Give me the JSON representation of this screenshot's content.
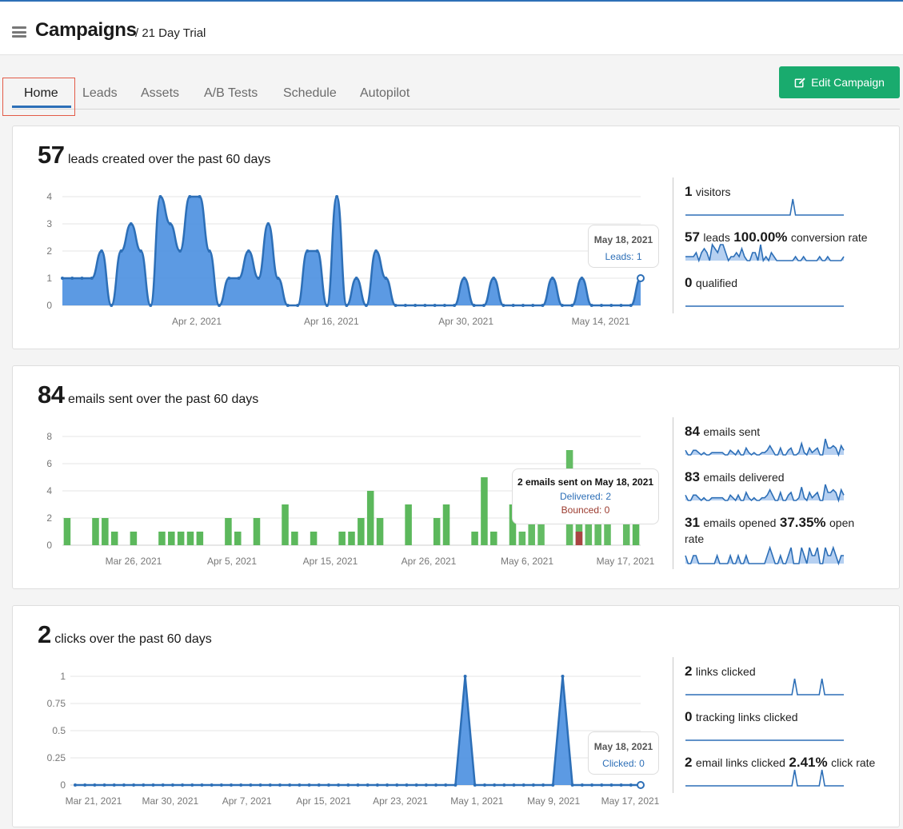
{
  "header": {
    "title": "Campaigns",
    "subtitle": "/ 21 Day Trial"
  },
  "tabs": [
    "Home",
    "Leads",
    "Assets",
    "A/B Tests",
    "Schedule",
    "Autopilot"
  ],
  "edit_button": {
    "label": "Edit Campaign"
  },
  "colors": {
    "accent": "#2d6fb7",
    "area": "#4a8fe0",
    "bar": "#5cb85c",
    "bounced": "#a94442",
    "button": "#19ab6e"
  },
  "leads_panel": {
    "count": "57",
    "label": "leads created over the past 60 days",
    "tooltip": {
      "date": "May 18, 2021",
      "value": "Leads: 1"
    },
    "stats": {
      "visitors_n": "1",
      "visitors_t": "visitors",
      "leads_n": "57",
      "leads_t": "leads",
      "conv_n": "100.00%",
      "conv_t": "conversion rate",
      "qualified_n": "0",
      "qualified_t": "qualified"
    }
  },
  "emails_panel": {
    "count": "84",
    "label": "emails sent over the past 60 days",
    "tooltip": {
      "title": "2 emails sent on May 18, 2021",
      "delivered": "Delivered: 2",
      "bounced": "Bounced: 0"
    },
    "stats": {
      "sent_n": "84",
      "sent_t": "emails sent",
      "delivered_n": "83",
      "delivered_t": "emails delivered",
      "opened_n": "31",
      "opened_t": "emails opened",
      "rate_n": "37.35%",
      "rate_t": "open",
      "rate_t2": "rate"
    }
  },
  "clicks_panel": {
    "count": "2",
    "label": "clicks over the past 60 days",
    "tooltip": {
      "date": "May 18, 2021",
      "value": "Clicked: 0"
    },
    "stats": {
      "links_n": "2",
      "links_t": "links clicked",
      "tracking_n": "0",
      "tracking_t": "tracking links clicked",
      "email_n": "2",
      "email_t": "email links clicked",
      "click_n": "2.41%",
      "click_t": "click rate"
    }
  },
  "chart_data": [
    {
      "type": "area",
      "title": "57 leads created over the past 60 days",
      "x_ticks": [
        "Apr 2, 2021",
        "Apr 16, 2021",
        "Apr 30, 2021",
        "May 14, 2021"
      ],
      "y_ticks": [
        "0",
        "1",
        "2",
        "3",
        "4"
      ],
      "ylim": [
        0,
        4
      ],
      "values": [
        1,
        1,
        1,
        1,
        2,
        0,
        2,
        3,
        2,
        0,
        4,
        3,
        2,
        4,
        4,
        2,
        0,
        1,
        1,
        2,
        1,
        3,
        1,
        0,
        0,
        2,
        2,
        0,
        4,
        0,
        1,
        0,
        2,
        1,
        0,
        0,
        0,
        0,
        0,
        0,
        0,
        1,
        0,
        0,
        1,
        0,
        0,
        0,
        0,
        0,
        1,
        0,
        0,
        1,
        0,
        0,
        0,
        0,
        0,
        1
      ],
      "grid": true
    },
    {
      "type": "bar",
      "title": "84 emails sent over the past 60 days",
      "x_ticks": [
        "Mar 26, 2021",
        "Apr 5, 2021",
        "Apr 15, 2021",
        "Apr 26, 2021",
        "May 6, 2021",
        "May 17, 2021"
      ],
      "y_ticks": [
        "0",
        "2",
        "4",
        "6",
        "8"
      ],
      "ylim": [
        0,
        8
      ],
      "series": [
        {
          "name": "Delivered",
          "values": [
            2,
            0,
            0,
            2,
            2,
            1,
            0,
            1,
            0,
            0,
            1,
            1,
            1,
            1,
            1,
            0,
            0,
            2,
            1,
            0,
            2,
            0,
            0,
            3,
            1,
            0,
            1,
            0,
            0,
            1,
            1,
            2,
            4,
            2,
            0,
            0,
            3,
            0,
            0,
            2,
            3,
            0,
            0,
            1,
            5,
            1,
            0,
            3,
            1,
            2,
            3,
            0,
            0,
            7,
            3,
            3,
            4,
            3,
            0,
            4,
            2
          ]
        },
        {
          "name": "Bounced",
          "values": [
            0,
            0,
            0,
            0,
            0,
            0,
            0,
            0,
            0,
            0,
            0,
            0,
            0,
            0,
            0,
            0,
            0,
            0,
            0,
            0,
            0,
            0,
            0,
            0,
            0,
            0,
            0,
            0,
            0,
            0,
            0,
            0,
            0,
            0,
            0,
            0,
            0,
            0,
            0,
            0,
            0,
            0,
            0,
            0,
            0,
            0,
            0,
            0,
            0,
            0,
            0,
            0,
            0,
            0,
            1,
            0,
            0,
            0,
            0,
            0,
            0
          ]
        }
      ],
      "grid": true
    },
    {
      "type": "area",
      "title": "2 clicks over the past 60 days",
      "x_ticks": [
        "Mar 21, 2021",
        "Mar 30, 2021",
        "Apr 7, 2021",
        "Apr 15, 2021",
        "Apr 23, 2021",
        "May 1, 2021",
        "May 9, 2021",
        "May 17, 2021"
      ],
      "y_ticks": [
        "0",
        "0.25",
        "0.5",
        "0.75",
        "1"
      ],
      "ylim": [
        0,
        1
      ],
      "values": [
        0,
        0,
        0,
        0,
        0,
        0,
        0,
        0,
        0,
        0,
        0,
        0,
        0,
        0,
        0,
        0,
        0,
        0,
        0,
        0,
        0,
        0,
        0,
        0,
        0,
        0,
        0,
        0,
        0,
        0,
        0,
        0,
        0,
        0,
        0,
        0,
        0,
        0,
        0,
        0,
        1,
        0,
        0,
        0,
        0,
        0,
        0,
        0,
        0,
        0,
        1,
        0,
        0,
        0,
        0,
        0,
        0,
        0,
        0
      ],
      "grid": true
    }
  ],
  "sparklines": {
    "visitors": [
      0,
      0,
      0,
      0,
      0,
      0,
      0,
      0,
      0,
      0,
      0,
      0,
      0,
      0,
      0,
      0,
      0,
      0,
      0,
      0,
      0,
      0,
      0,
      0,
      0,
      0,
      0,
      0,
      0,
      0,
      0,
      0,
      0,
      0,
      0,
      0,
      0,
      0,
      0,
      0,
      1,
      0,
      0,
      0,
      0,
      0,
      0,
      0,
      0,
      0,
      0,
      0,
      0,
      0,
      0,
      0,
      0,
      0,
      0,
      0
    ],
    "leads": [
      1,
      1,
      1,
      1,
      2,
      0,
      2,
      3,
      2,
      0,
      4,
      3,
      2,
      4,
      4,
      2,
      0,
      1,
      1,
      2,
      1,
      3,
      1,
      0,
      0,
      2,
      2,
      0,
      4,
      0,
      1,
      0,
      2,
      1,
      0,
      0,
      0,
      0,
      0,
      0,
      0,
      1,
      0,
      0,
      1,
      0,
      0,
      0,
      0,
      0,
      1,
      0,
      0,
      1,
      0,
      0,
      0,
      0,
      0,
      1
    ],
    "qualified": [
      0,
      0,
      0,
      0,
      0,
      0,
      0,
      0,
      0,
      0,
      0,
      0,
      0,
      0,
      0,
      0,
      0,
      0,
      0,
      0,
      0,
      0,
      0,
      0,
      0,
      0,
      0,
      0,
      0,
      0,
      0,
      0,
      0,
      0,
      0,
      0,
      0,
      0,
      0,
      0,
      0,
      0,
      0,
      0,
      0,
      0,
      0,
      0,
      0,
      0,
      0,
      0,
      0,
      0,
      0,
      0,
      0,
      0,
      0,
      0
    ],
    "sent": [
      2,
      0,
      0,
      2,
      2,
      1,
      0,
      1,
      0,
      0,
      1,
      1,
      1,
      1,
      1,
      0,
      0,
      2,
      1,
      0,
      2,
      0,
      0,
      3,
      1,
      0,
      1,
      0,
      0,
      1,
      1,
      2,
      4,
      2,
      0,
      0,
      3,
      0,
      0,
      2,
      3,
      0,
      0,
      1,
      5,
      1,
      0,
      3,
      1,
      2,
      3,
      0,
      0,
      7,
      3,
      3,
      4,
      3,
      0,
      4,
      2
    ],
    "delivered": [
      2,
      0,
      0,
      2,
      2,
      1,
      0,
      1,
      0,
      0,
      1,
      1,
      1,
      1,
      1,
      0,
      0,
      2,
      1,
      0,
      2,
      0,
      0,
      3,
      1,
      0,
      1,
      0,
      0,
      1,
      1,
      2,
      4,
      2,
      0,
      0,
      3,
      0,
      0,
      2,
      3,
      0,
      0,
      1,
      5,
      1,
      0,
      3,
      1,
      2,
      3,
      0,
      0,
      6,
      3,
      3,
      4,
      3,
      0,
      4,
      2
    ],
    "opened": [
      1,
      0,
      0,
      1,
      1,
      0,
      0,
      0,
      0,
      0,
      0,
      0,
      1,
      0,
      0,
      0,
      0,
      1,
      0,
      0,
      1,
      0,
      0,
      1,
      0,
      0,
      0,
      0,
      0,
      0,
      0,
      1,
      2,
      1,
      0,
      0,
      1,
      0,
      0,
      1,
      2,
      0,
      0,
      0,
      2,
      1,
      0,
      2,
      1,
      1,
      2,
      0,
      0,
      2,
      1,
      1,
      2,
      1,
      0,
      1,
      1
    ],
    "links": [
      0,
      0,
      0,
      0,
      0,
      0,
      0,
      0,
      0,
      0,
      0,
      0,
      0,
      0,
      0,
      0,
      0,
      0,
      0,
      0,
      0,
      0,
      0,
      0,
      0,
      0,
      0,
      0,
      0,
      0,
      0,
      0,
      0,
      0,
      0,
      0,
      0,
      0,
      0,
      0,
      1,
      0,
      0,
      0,
      0,
      0,
      0,
      0,
      0,
      0,
      1,
      0,
      0,
      0,
      0,
      0,
      0,
      0,
      0
    ],
    "tracking": [
      0,
      0,
      0,
      0,
      0,
      0,
      0,
      0,
      0,
      0,
      0,
      0,
      0,
      0,
      0,
      0,
      0,
      0,
      0,
      0,
      0,
      0,
      0,
      0,
      0,
      0,
      0,
      0,
      0,
      0,
      0,
      0,
      0,
      0,
      0,
      0,
      0,
      0,
      0,
      0,
      0,
      0,
      0,
      0,
      0,
      0,
      0,
      0,
      0,
      0,
      0,
      0,
      0,
      0,
      0,
      0,
      0,
      0,
      0
    ],
    "emaillinks": [
      0,
      0,
      0,
      0,
      0,
      0,
      0,
      0,
      0,
      0,
      0,
      0,
      0,
      0,
      0,
      0,
      0,
      0,
      0,
      0,
      0,
      0,
      0,
      0,
      0,
      0,
      0,
      0,
      0,
      0,
      0,
      0,
      0,
      0,
      0,
      0,
      0,
      0,
      0,
      0,
      1,
      0,
      0,
      0,
      0,
      0,
      0,
      0,
      0,
      0,
      1,
      0,
      0,
      0,
      0,
      0,
      0,
      0,
      0
    ]
  }
}
